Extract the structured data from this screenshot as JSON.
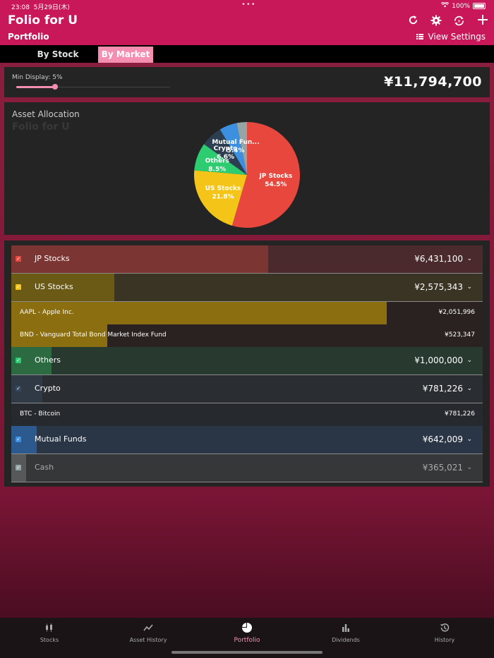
{
  "status": {
    "time": "23:08",
    "date": "5月29日(木)",
    "battery": "100%"
  },
  "header": {
    "title": "Folio for U",
    "subtitle": "Portfolio",
    "view_settings": "View Settings",
    "icons": [
      "refresh-icon",
      "gear-icon",
      "sync-icon",
      "add-icon"
    ]
  },
  "tabs": [
    {
      "label": "By Stock",
      "active": false
    },
    {
      "label": "By Market",
      "active": true
    }
  ],
  "summary": {
    "min_display": "Min Display: 5%",
    "min_display_value": 5,
    "total": "¥11,794,700"
  },
  "allocation": {
    "title": "Asset Allocation",
    "subtitle": "Folio for U"
  },
  "chart_data": {
    "type": "pie",
    "slices": [
      {
        "name": "JP Stocks",
        "percent": 54.5,
        "label": "54.5%",
        "color": "#e8473d"
      },
      {
        "name": "US Stocks",
        "percent": 21.8,
        "label": "21.8%",
        "color": "#f4c518"
      },
      {
        "name": "Others",
        "percent": 8.5,
        "label": "8.5%",
        "color": "#2ecc71"
      },
      {
        "name": "Crypto",
        "percent": 6.6,
        "label": "6.6%",
        "color": "#2c3e50"
      },
      {
        "name": "Mutual Fun...",
        "percent": 5.4,
        "label": "5.4%",
        "color": "#3d8fe0"
      },
      {
        "name": "Cash",
        "percent": 3.1,
        "label": "",
        "color": "#95a5a6"
      }
    ]
  },
  "rows": [
    {
      "kind": "cat",
      "label": "JP Stocks",
      "amount": "¥6,431,100",
      "fraction": 0.545,
      "color": "#e8473d",
      "bg": "#4a2a2c",
      "barColor": "#7b3532"
    },
    {
      "kind": "cat",
      "label": "US Stocks",
      "amount": "¥2,575,343",
      "fraction": 0.218,
      "color": "#f4c518",
      "bg": "#3a3424",
      "barColor": "#6a5a16"
    },
    {
      "kind": "sub",
      "label": "AAPL - Apple Inc.",
      "amount": "¥2,051,996",
      "fraction": 0.797,
      "bg": "#2a2220",
      "barColor": "#8a6e10"
    },
    {
      "kind": "sub",
      "label": "BND - Vanguard Total Bond Market Index Fund",
      "amount": "¥523,347",
      "fraction": 0.203,
      "bg": "#2a2220",
      "barColor": "#8a6e10"
    },
    {
      "kind": "cat",
      "label": "Others",
      "amount": "¥1,000,000",
      "fraction": 0.085,
      "color": "#2ecc71",
      "bg": "#283a30",
      "barColor": "#2c6b42"
    },
    {
      "kind": "cat",
      "label": "Crypto",
      "amount": "¥781,226",
      "fraction": 0.066,
      "color": "#34495e",
      "bg": "#2a2e33",
      "barColor": "#2f3a46"
    },
    {
      "kind": "sub",
      "label": "BTC - Bitcoin",
      "amount": "¥781,226",
      "fraction": 0,
      "bg": "#262a2e",
      "barColor": "#2f3a46"
    },
    {
      "kind": "cat",
      "label": "Mutual Funds",
      "amount": "¥642,009",
      "fraction": 0.054,
      "color": "#3d8fe0",
      "bg": "#2a3646",
      "barColor": "#2d5a8e"
    },
    {
      "kind": "cat",
      "label": "Cash",
      "amount": "¥365,021",
      "fraction": 0.031,
      "color": "#95a5a6",
      "bg": "#353738",
      "barColor": "#56595a",
      "muted": true
    }
  ],
  "nav": [
    {
      "label": "Stocks",
      "icon": "candlestick-icon",
      "active": false
    },
    {
      "label": "Asset History",
      "icon": "line-chart-icon",
      "active": false
    },
    {
      "label": "Portfolio",
      "icon": "pie-chart-icon",
      "active": true
    },
    {
      "label": "Dividends",
      "icon": "bar-chart-icon",
      "active": false
    },
    {
      "label": "History",
      "icon": "history-icon",
      "active": false
    }
  ]
}
